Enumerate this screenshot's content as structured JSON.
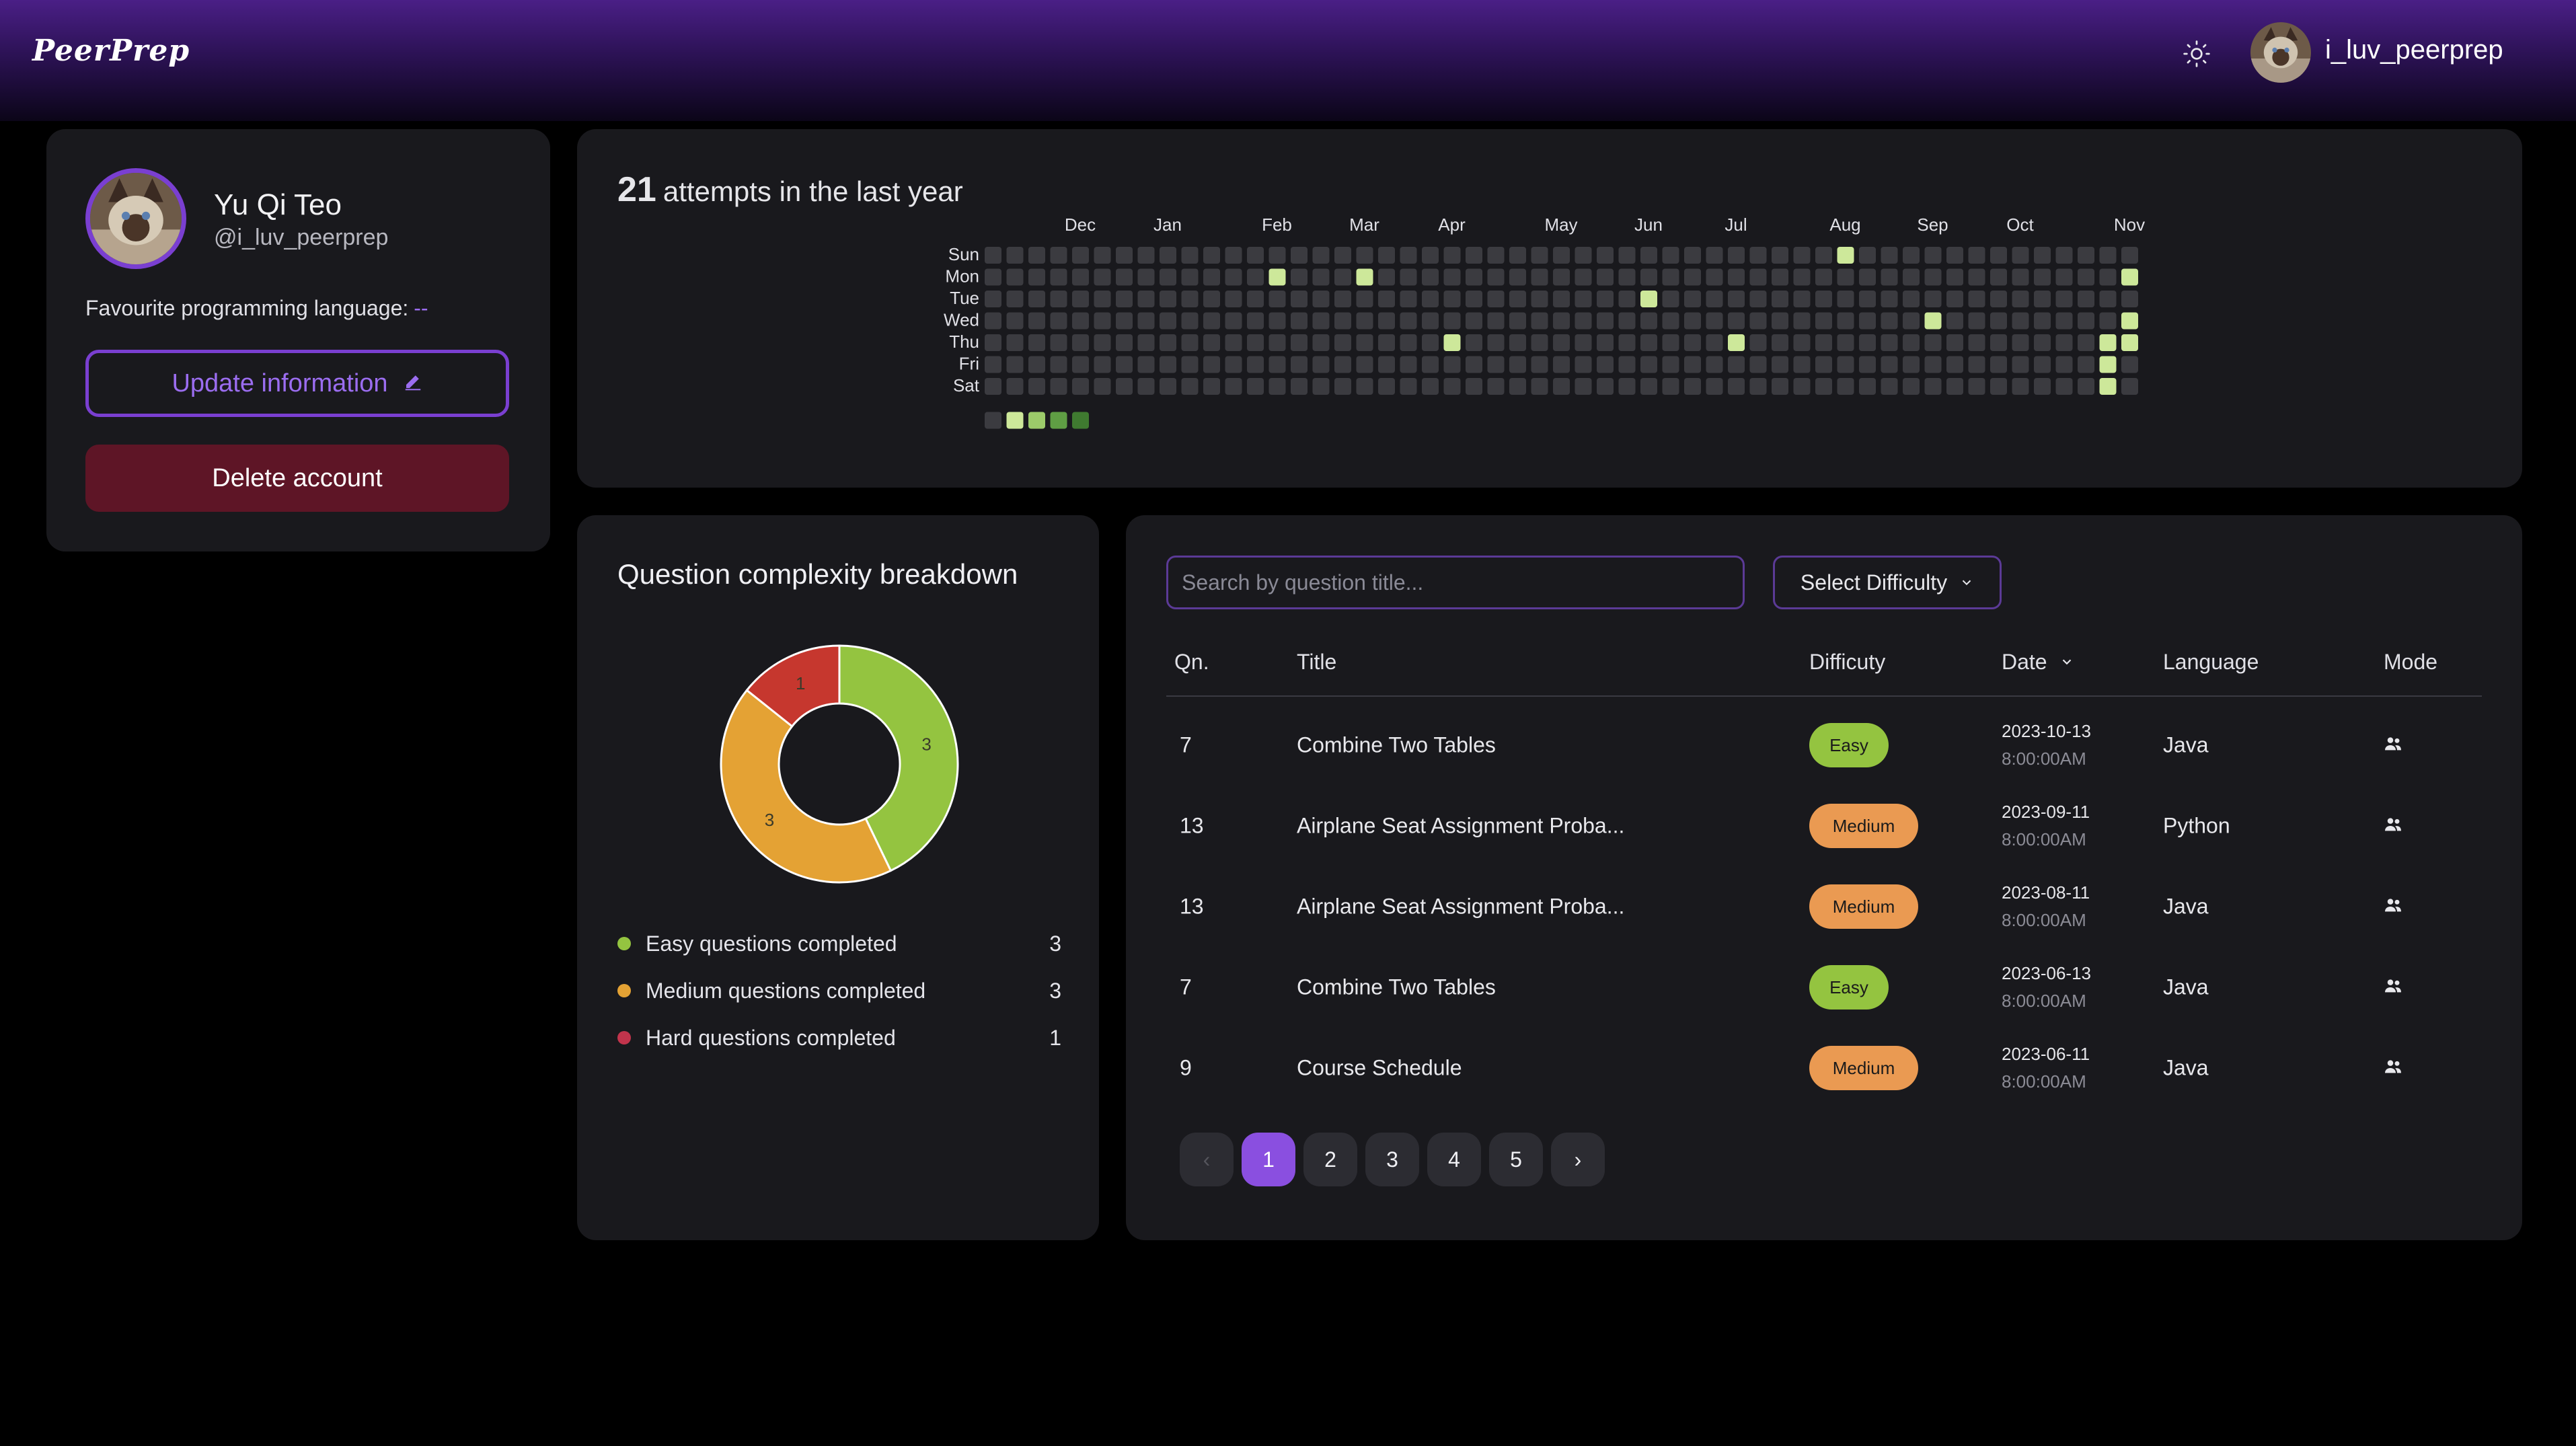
{
  "app": {
    "brand": "PeerPrep"
  },
  "header": {
    "username": "i_luv_peerprep",
    "theme_icon": "sun-icon",
    "avatar": "cat-avatar"
  },
  "profile": {
    "name": "Yu Qi Teo",
    "handle": "@i_luv_peerprep",
    "fav_lang_label": "Favourite programming language:",
    "fav_lang_value": "--",
    "update_label": "Update information",
    "update_icon": "pencil-icon",
    "delete_label": "Delete account"
  },
  "heatmap": {
    "count": "21",
    "title_suffix": "attempts in the last year",
    "day_labels": [
      "Sun",
      "Mon",
      "Tue",
      "Wed",
      "Thu",
      "Fri",
      "Sat"
    ],
    "month_labels": [
      {
        "label": "Dec",
        "week": 4
      },
      {
        "label": "Jan",
        "week": 8
      },
      {
        "label": "Feb",
        "week": 13
      },
      {
        "label": "Mar",
        "week": 17
      },
      {
        "label": "Apr",
        "week": 21
      },
      {
        "label": "May",
        "week": 26
      },
      {
        "label": "Jun",
        "week": 30
      },
      {
        "label": "Jul",
        "week": 34
      },
      {
        "label": "Aug",
        "week": 39
      },
      {
        "label": "Sep",
        "week": 43
      },
      {
        "label": "Oct",
        "week": 47
      },
      {
        "label": "Nov",
        "week": 52
      }
    ],
    "weeks": 53,
    "active_cells": [
      {
        "week": 13,
        "day": 1
      },
      {
        "week": 17,
        "day": 1
      },
      {
        "week": 21,
        "day": 4
      },
      {
        "week": 30,
        "day": 2
      },
      {
        "week": 34,
        "day": 4
      },
      {
        "week": 39,
        "day": 0
      },
      {
        "week": 43,
        "day": 3
      },
      {
        "week": 51,
        "day": 4
      },
      {
        "week": 51,
        "day": 5
      },
      {
        "week": 51,
        "day": 6
      },
      {
        "week": 52,
        "day": 1
      },
      {
        "week": 52,
        "day": 3
      },
      {
        "week": 52,
        "day": 4
      }
    ],
    "colors": {
      "empty": "#3b3b40",
      "active": "#cde89a",
      "scale": [
        "#3b3b40",
        "#cde89a",
        "#9ccb6a",
        "#5f9e44",
        "#3f7a30"
      ]
    }
  },
  "complexity": {
    "title": "Question complexity breakdown",
    "legend": [
      {
        "label": "Easy questions completed",
        "value": "3",
        "color": "#94c440"
      },
      {
        "label": "Medium questions completed",
        "value": "3",
        "color": "#e4a234"
      },
      {
        "label": "Hard questions completed",
        "value": "1",
        "color": "#c2344c"
      }
    ]
  },
  "chart_data": {
    "type": "pie",
    "categories": [
      "Easy",
      "Medium",
      "Hard"
    ],
    "values": [
      3,
      3,
      1
    ],
    "colors": [
      "#94c440",
      "#e4a234",
      "#c6372e"
    ],
    "title": "Question complexity breakdown"
  },
  "history": {
    "search_placeholder": "Search by question title...",
    "difficulty_select": "Select Difficulty",
    "columns": [
      "Qn.",
      "Title",
      "Difficuty",
      "Date",
      "Language",
      "Mode"
    ],
    "rows": [
      {
        "qn": "7",
        "title": "Combine Two Tables",
        "difficulty": "Easy",
        "date": "2023-10-13",
        "time": "8:00:00AM",
        "language": "Java",
        "mode_icon": "users-icon"
      },
      {
        "qn": "13",
        "title": "Airplane Seat Assignment Proba...",
        "difficulty": "Medium",
        "date": "2023-09-11",
        "time": "8:00:00AM",
        "language": "Python",
        "mode_icon": "users-icon"
      },
      {
        "qn": "13",
        "title": "Airplane Seat Assignment Proba...",
        "difficulty": "Medium",
        "date": "2023-08-11",
        "time": "8:00:00AM",
        "language": "Java",
        "mode_icon": "users-icon"
      },
      {
        "qn": "7",
        "title": "Combine Two Tables",
        "difficulty": "Easy",
        "date": "2023-06-13",
        "time": "8:00:00AM",
        "language": "Java",
        "mode_icon": "users-icon"
      },
      {
        "qn": "9",
        "title": "Course Schedule",
        "difficulty": "Medium",
        "date": "2023-06-11",
        "time": "8:00:00AM",
        "language": "Java",
        "mode_icon": "users-icon"
      }
    ],
    "difficulty_colors": {
      "Easy": "#94c440",
      "Medium": "#ea9a52"
    },
    "pagination": {
      "pages": [
        "1",
        "2",
        "3",
        "4",
        "5"
      ],
      "current": "1",
      "prev": "‹",
      "next": "›"
    }
  }
}
